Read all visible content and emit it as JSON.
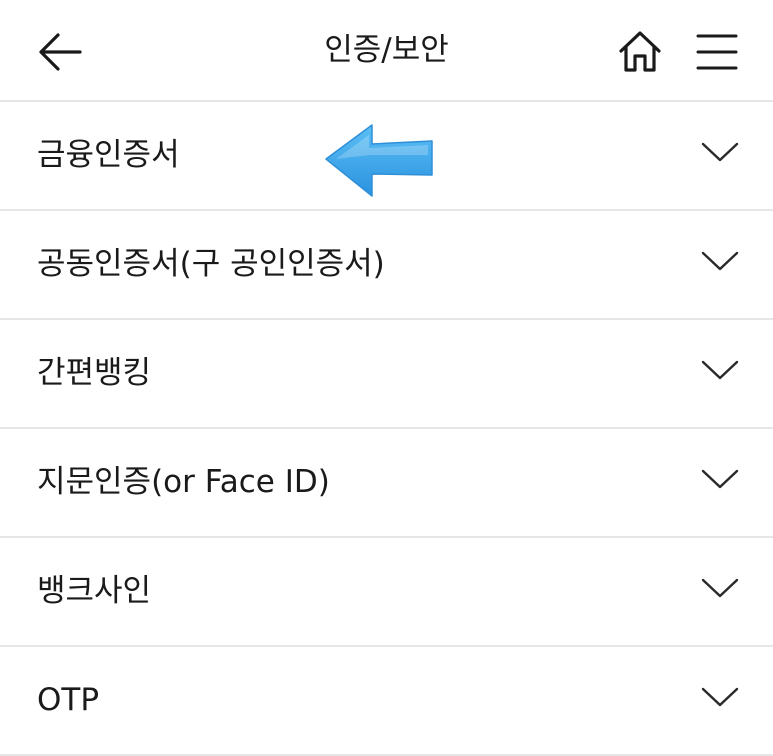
{
  "header": {
    "title": "인증/보안",
    "back_icon": "arrow-left-icon",
    "home_icon": "home-icon",
    "menu_icon": "hamburger-menu-icon"
  },
  "menu": {
    "items": [
      {
        "label": "금융인증서"
      },
      {
        "label": "공동인증서(구 공인인증서)"
      },
      {
        "label": "간편뱅킹"
      },
      {
        "label": "지문인증(or Face ID)"
      },
      {
        "label": "뱅크사인"
      },
      {
        "label": "OTP"
      }
    ],
    "expand_icon": "chevron-down-icon"
  },
  "annotation": {
    "arrow_icon": "blue-pointer-arrow-icon",
    "arrow_color": "#3aa6ea"
  },
  "colors": {
    "text": "#1a1a1a",
    "divider": "#e6e6e6",
    "background": "#ffffff"
  }
}
